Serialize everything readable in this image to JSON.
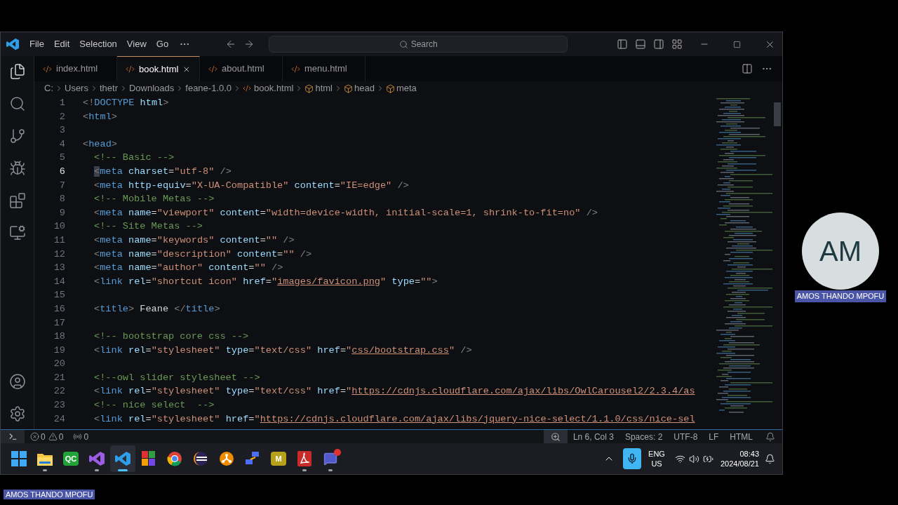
{
  "menu": [
    "File",
    "Edit",
    "Selection",
    "View",
    "Go"
  ],
  "search": {
    "placeholder": "Search"
  },
  "tabs": [
    {
      "label": "index.html",
      "selected": false
    },
    {
      "label": "book.html",
      "selected": true
    },
    {
      "label": "about.html",
      "selected": false
    },
    {
      "label": "menu.html",
      "selected": false
    }
  ],
  "breadcrumb": [
    {
      "kind": "folder",
      "text": "C:"
    },
    {
      "kind": "folder",
      "text": "Users"
    },
    {
      "kind": "folder",
      "text": "thetr"
    },
    {
      "kind": "folder",
      "text": "Downloads"
    },
    {
      "kind": "folder",
      "text": "feane-1.0.0"
    },
    {
      "kind": "file",
      "text": "book.html"
    },
    {
      "kind": "symbol",
      "text": "html"
    },
    {
      "kind": "symbol",
      "text": "head"
    },
    {
      "kind": "symbol",
      "text": "meta"
    }
  ],
  "lines": [
    {
      "number": "1",
      "active": false,
      "indented": false,
      "tokens": [
        {
          "kind": "punct",
          "text": "<!"
        },
        {
          "kind": "tag",
          "text": "DOCTYPE"
        },
        {
          "kind": "attr",
          "text": " html"
        },
        {
          "kind": "punct",
          "text": ">"
        }
      ]
    },
    {
      "number": "2",
      "active": false,
      "indented": false,
      "tokens": [
        {
          "kind": "punct",
          "text": "<"
        },
        {
          "kind": "tag",
          "text": "html"
        },
        {
          "kind": "punct",
          "text": ">"
        }
      ]
    },
    {
      "number": "3",
      "active": false
    },
    {
      "number": "4",
      "active": false,
      "indented": false,
      "tokens": [
        {
          "kind": "punct",
          "text": "<"
        },
        {
          "kind": "tag",
          "text": "head"
        },
        {
          "kind": "punct",
          "text": ">"
        }
      ]
    },
    {
      "number": "5",
      "active": false,
      "indented": true,
      "tokens": [
        {
          "kind": "comment",
          "text": "<!-- Basic -->"
        }
      ]
    },
    {
      "number": "6",
      "active": true,
      "indented": true,
      "tokens": [
        {
          "kind": "punct",
          "text": "<"
        },
        {
          "kind": "tag",
          "text": "meta"
        },
        {
          "kind": "attr",
          "text": " charset"
        },
        {
          "kind": "text",
          "text": "="
        },
        {
          "kind": "string",
          "text": "\"utf-8\""
        },
        {
          "kind": "punct",
          "text": " />"
        }
      ]
    },
    {
      "number": "7",
      "active": false,
      "indented": true,
      "tokens": [
        {
          "kind": "punct",
          "text": "<"
        },
        {
          "kind": "tag",
          "text": "meta"
        },
        {
          "kind": "attr",
          "text": " http-equiv"
        },
        {
          "kind": "text",
          "text": "="
        },
        {
          "kind": "string",
          "text": "\"X-UA-Compatible\""
        },
        {
          "kind": "attr",
          "text": " content"
        },
        {
          "kind": "text",
          "text": "="
        },
        {
          "kind": "string",
          "text": "\"IE=edge\""
        },
        {
          "kind": "punct",
          "text": " />"
        }
      ]
    },
    {
      "number": "8",
      "active": false,
      "indented": true,
      "tokens": [
        {
          "kind": "comment",
          "text": "<!-- Mobile Metas -->"
        }
      ]
    },
    {
      "number": "9",
      "active": false,
      "indented": true,
      "tokens": [
        {
          "kind": "punct",
          "text": "<"
        },
        {
          "kind": "tag",
          "text": "meta"
        },
        {
          "kind": "attr",
          "text": " name"
        },
        {
          "kind": "text",
          "text": "="
        },
        {
          "kind": "string",
          "text": "\"viewport\""
        },
        {
          "kind": "attr",
          "text": " content"
        },
        {
          "kind": "text",
          "text": "="
        },
        {
          "kind": "string",
          "text": "\"width=device-width, initial-scale=1, shrink-to-fit=no\""
        },
        {
          "kind": "punct",
          "text": " />"
        }
      ]
    },
    {
      "number": "10",
      "active": false,
      "indented": true,
      "tokens": [
        {
          "kind": "comment",
          "text": "<!-- Site Metas -->"
        }
      ]
    },
    {
      "number": "11",
      "active": false,
      "indented": true,
      "tokens": [
        {
          "kind": "punct",
          "text": "<"
        },
        {
          "kind": "tag",
          "text": "meta"
        },
        {
          "kind": "attr",
          "text": " name"
        },
        {
          "kind": "text",
          "text": "="
        },
        {
          "kind": "string",
          "text": "\"keywords\""
        },
        {
          "kind": "attr",
          "text": " content"
        },
        {
          "kind": "text",
          "text": "="
        },
        {
          "kind": "string",
          "text": "\"\""
        },
        {
          "kind": "punct",
          "text": " />"
        }
      ]
    },
    {
      "number": "12",
      "active": false,
      "indented": true,
      "tokens": [
        {
          "kind": "punct",
          "text": "<"
        },
        {
          "kind": "tag",
          "text": "meta"
        },
        {
          "kind": "attr",
          "text": " name"
        },
        {
          "kind": "text",
          "text": "="
        },
        {
          "kind": "string",
          "text": "\"description\""
        },
        {
          "kind": "attr",
          "text": " content"
        },
        {
          "kind": "text",
          "text": "="
        },
        {
          "kind": "string",
          "text": "\"\""
        },
        {
          "kind": "punct",
          "text": " />"
        }
      ]
    },
    {
      "number": "13",
      "active": false,
      "indented": true,
      "tokens": [
        {
          "kind": "punct",
          "text": "<"
        },
        {
          "kind": "tag",
          "text": "meta"
        },
        {
          "kind": "attr",
          "text": " name"
        },
        {
          "kind": "text",
          "text": "="
        },
        {
          "kind": "string",
          "text": "\"author\""
        },
        {
          "kind": "attr",
          "text": " content"
        },
        {
          "kind": "text",
          "text": "="
        },
        {
          "kind": "string",
          "text": "\"\""
        },
        {
          "kind": "punct",
          "text": " />"
        }
      ]
    },
    {
      "number": "14",
      "active": false,
      "indented": true,
      "tokens": [
        {
          "kind": "punct",
          "text": "<"
        },
        {
          "kind": "tag",
          "text": "link"
        },
        {
          "kind": "attr",
          "text": " rel"
        },
        {
          "kind": "text",
          "text": "="
        },
        {
          "kind": "string",
          "text": "\"shortcut icon\""
        },
        {
          "kind": "attr",
          "text": " href"
        },
        {
          "kind": "text",
          "text": "="
        },
        {
          "kind": "string",
          "text": "\""
        },
        {
          "kind": "link",
          "text": "images/favicon.png"
        },
        {
          "kind": "string",
          "text": "\""
        },
        {
          "kind": "attr",
          "text": " type"
        },
        {
          "kind": "text",
          "text": "="
        },
        {
          "kind": "string",
          "text": "\"\""
        },
        {
          "kind": "punct",
          "text": ">"
        }
      ]
    },
    {
      "number": "15",
      "active": false
    },
    {
      "number": "16",
      "active": false,
      "indented": true,
      "tokens": [
        {
          "kind": "punct",
          "text": "<"
        },
        {
          "kind": "tag",
          "text": "title"
        },
        {
          "kind": "punct",
          "text": ">"
        },
        {
          "kind": "text",
          "text": " Feane "
        },
        {
          "kind": "punct",
          "text": "</"
        },
        {
          "kind": "tag",
          "text": "title"
        },
        {
          "kind": "punct",
          "text": ">"
        }
      ]
    },
    {
      "number": "17",
      "active": false
    },
    {
      "number": "18",
      "active": false,
      "indented": true,
      "tokens": [
        {
          "kind": "comment",
          "text": "<!-- bootstrap core css -->"
        }
      ]
    },
    {
      "number": "19",
      "active": false,
      "indented": true,
      "tokens": [
        {
          "kind": "punct",
          "text": "<"
        },
        {
          "kind": "tag",
          "text": "link"
        },
        {
          "kind": "attr",
          "text": " rel"
        },
        {
          "kind": "text",
          "text": "="
        },
        {
          "kind": "string",
          "text": "\"stylesheet\""
        },
        {
          "kind": "attr",
          "text": " type"
        },
        {
          "kind": "text",
          "text": "="
        },
        {
          "kind": "string",
          "text": "\"text/css\""
        },
        {
          "kind": "attr",
          "text": " href"
        },
        {
          "kind": "text",
          "text": "="
        },
        {
          "kind": "string",
          "text": "\""
        },
        {
          "kind": "link",
          "text": "css/bootstrap.css"
        },
        {
          "kind": "string",
          "text": "\""
        },
        {
          "kind": "punct",
          "text": " />"
        }
      ]
    },
    {
      "number": "20",
      "active": false
    },
    {
      "number": "21",
      "active": false,
      "indented": true,
      "tokens": [
        {
          "kind": "comment",
          "text": "<!--owl slider stylesheet -->"
        }
      ]
    },
    {
      "number": "22",
      "active": false,
      "indented": true,
      "tokens": [
        {
          "kind": "punct",
          "text": "<"
        },
        {
          "kind": "tag",
          "text": "link"
        },
        {
          "kind": "attr",
          "text": " rel"
        },
        {
          "kind": "text",
          "text": "="
        },
        {
          "kind": "string",
          "text": "\"stylesheet\""
        },
        {
          "kind": "attr",
          "text": " type"
        },
        {
          "kind": "text",
          "text": "="
        },
        {
          "kind": "string",
          "text": "\"text/css\""
        },
        {
          "kind": "attr",
          "text": " href"
        },
        {
          "kind": "text",
          "text": "="
        },
        {
          "kind": "string",
          "text": "\""
        },
        {
          "kind": "link",
          "text": "https://cdnjs.cloudflare.com/ajax/libs/OwlCarousel2/2.3.4/as"
        }
      ]
    },
    {
      "number": "23",
      "active": false,
      "indented": true,
      "tokens": [
        {
          "kind": "comment",
          "text": "<!-- nice select  -->"
        }
      ]
    },
    {
      "number": "24",
      "active": false,
      "indented": true,
      "tokens": [
        {
          "kind": "punct",
          "text": "<"
        },
        {
          "kind": "tag",
          "text": "link"
        },
        {
          "kind": "attr",
          "text": " rel"
        },
        {
          "kind": "text",
          "text": "="
        },
        {
          "kind": "string",
          "text": "\"stylesheet\""
        },
        {
          "kind": "attr",
          "text": " href"
        },
        {
          "kind": "text",
          "text": "="
        },
        {
          "kind": "string",
          "text": "\""
        },
        {
          "kind": "link",
          "text": "https://cdnjs.cloudflare.com/ajax/libs/jquery-nice-select/1.1.0/css/nice-sel"
        }
      ]
    }
  ],
  "status_bar": {
    "errors": "0",
    "warnings": "0",
    "ports": "0",
    "items": [
      "Ln 6, Col 3",
      "Spaces: 2",
      "UTF-8",
      "LF",
      "HTML"
    ]
  },
  "taskbar": {
    "apps": [
      {
        "kind": "start",
        "running": false,
        "selected": false
      },
      {
        "kind": "folder",
        "running": true,
        "selected": false
      },
      {
        "kind": "tile",
        "text": "QC",
        "color": "#22a33a",
        "running": false,
        "selected": false
      },
      {
        "kind": "purple-editor",
        "running": true,
        "selected": false
      },
      {
        "kind": "blue-editor",
        "running": true,
        "selected": true
      },
      {
        "kind": "grid",
        "running": false,
        "selected": false
      },
      {
        "kind": "ring",
        "running": false,
        "selected": false
      },
      {
        "kind": "eclipse",
        "running": false,
        "selected": false
      },
      {
        "kind": "orange-circle",
        "running": false,
        "selected": false
      },
      {
        "kind": "network",
        "running": false,
        "selected": false
      },
      {
        "kind": "tile",
        "text": "M",
        "color": "#b5a21a",
        "running": false,
        "selected": false
      },
      {
        "kind": "pdf",
        "running": true,
        "selected": false
      },
      {
        "kind": "chat",
        "running": true,
        "selected": false
      }
    ],
    "language": "ENG",
    "region": "US",
    "time": "08:43",
    "date": "2024/08/21"
  },
  "participant": {
    "initials": "AM",
    "name": "AMOS THANDO MPOFU"
  },
  "self_label": "AMOS THANDO MPOFU"
}
